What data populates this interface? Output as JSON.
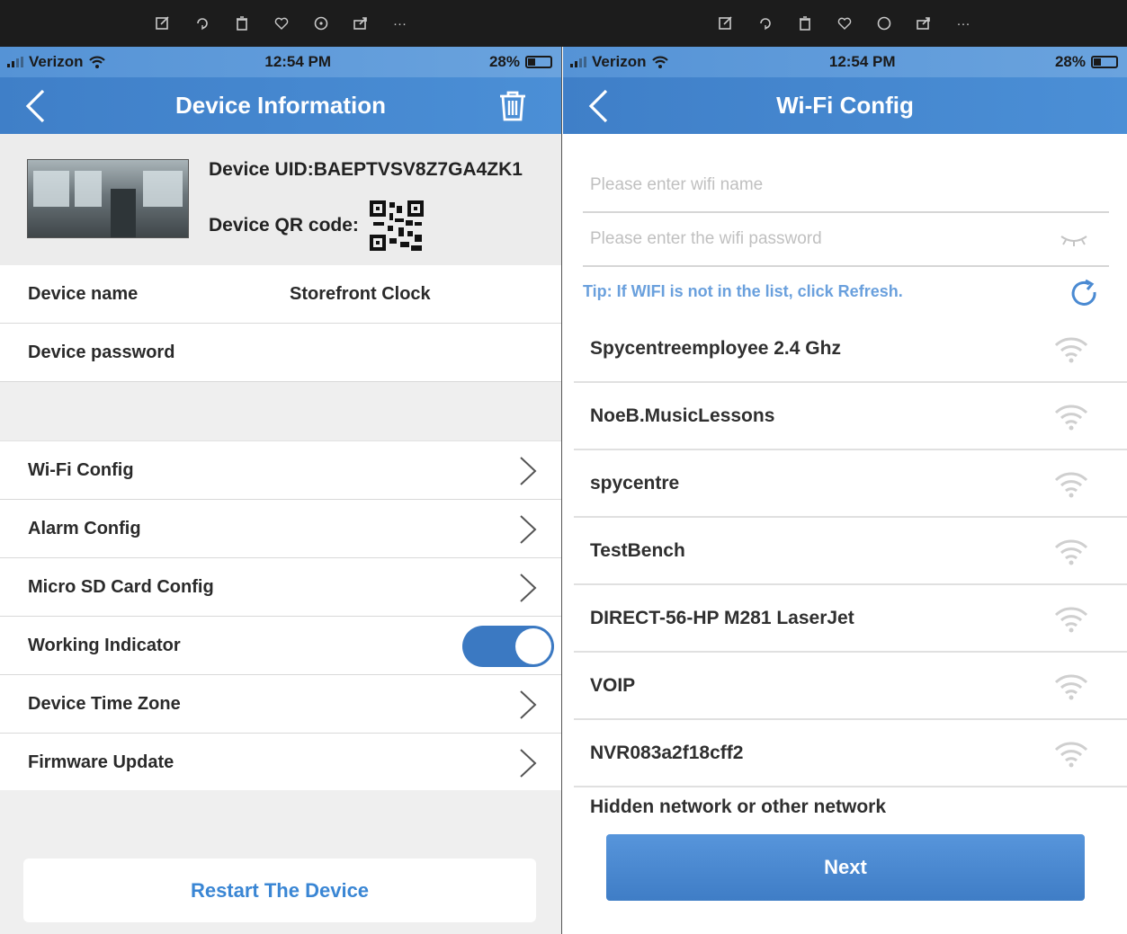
{
  "left": {
    "status": {
      "carrier": "Verizon",
      "time": "12:54 PM",
      "battery": "28%"
    },
    "title": "Device Information",
    "device": {
      "uid": "Device UID:BAEPTVSV8Z7GA4ZK1",
      "qr_label": "Device QR code:"
    },
    "fields": {
      "name_label": "Device name",
      "name_value": "Storefront Clock",
      "password_label": "Device password"
    },
    "menu": [
      {
        "label": "Wi-Fi Config"
      },
      {
        "label": "Alarm Config"
      },
      {
        "label": "Micro SD Card Config"
      }
    ],
    "working_indicator": {
      "label": "Working Indicator",
      "on": true
    },
    "menu2": [
      {
        "label": "Device Time Zone"
      },
      {
        "label": "Firmware Update"
      }
    ],
    "restart_label": "Restart The Device"
  },
  "right": {
    "status": {
      "carrier": "Verizon",
      "time": "12:54 PM",
      "battery": "28%"
    },
    "title": "Wi-Fi Config",
    "wifi_name_placeholder": "Please enter wifi name",
    "wifi_password_placeholder": "Please enter the wifi password",
    "tip": "Tip: If WIFI is not in the list, click Refresh.",
    "networks": [
      {
        "ssid": "Spycentreemployee 2.4 Ghz"
      },
      {
        "ssid": "NoeB.MusicLessons"
      },
      {
        "ssid": "spycentre"
      },
      {
        "ssid": "TestBench"
      },
      {
        "ssid": "DIRECT-56-HP M281 LaserJet"
      },
      {
        "ssid": "VOIP"
      },
      {
        "ssid": "NVR083a2f18cff2"
      }
    ],
    "hidden_network": "Hidden network or other network",
    "next_label": "Next"
  },
  "colors": {
    "accent": "#4a8ad2",
    "link": "#3a86d4",
    "toggle_on": "#3b79c2"
  }
}
